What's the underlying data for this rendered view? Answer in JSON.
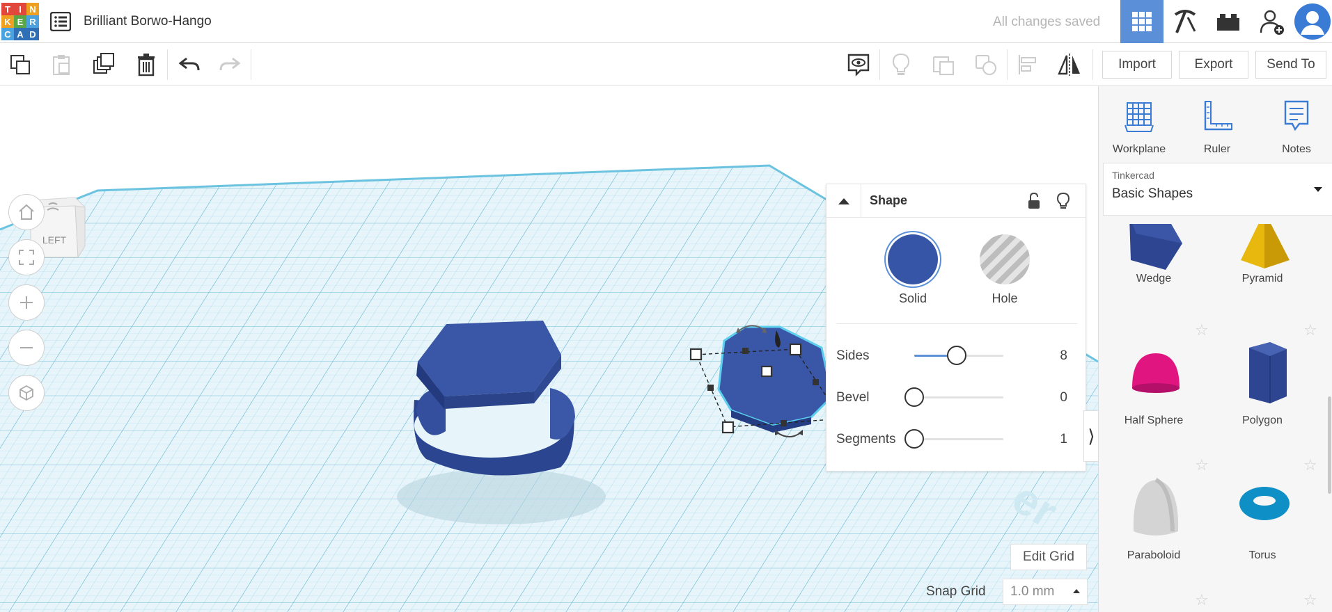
{
  "header": {
    "logo_letters": [
      "T",
      "I",
      "N",
      "K",
      "E",
      "R",
      "C",
      "A",
      "D"
    ],
    "logo_colors": [
      "#e2473b",
      "#e2473b",
      "#f0a020",
      "#f0a020",
      "#5ba646",
      "#4aa3df",
      "#4aa3df",
      "#2f6fb5",
      "#2f6fb5"
    ],
    "project_title": "Brilliant Borwo-Hango",
    "save_status": "All changes saved",
    "accent_color": "#5b8fd8"
  },
  "toolbar": {
    "import_label": "Import",
    "export_label": "Export",
    "send_to_label": "Send To"
  },
  "viewport": {
    "viewcube_label": "LEFT",
    "shape_color": "#2f4b9a",
    "grid_color": "#7fc8e0"
  },
  "inspector": {
    "title": "Shape",
    "solid_label": "Solid",
    "hole_label": "Hole",
    "solid_color": "#3655a6",
    "params": [
      {
        "label": "Sides",
        "value": "8",
        "fraction": 0.48
      },
      {
        "label": "Bevel",
        "value": "0",
        "fraction": 0.0
      },
      {
        "label": "Segments",
        "value": "1",
        "fraction": 0.0
      }
    ]
  },
  "grid_controls": {
    "edit_grid_label": "Edit Grid",
    "snap_grid_label": "Snap Grid",
    "snap_grid_value": "1.0 mm"
  },
  "panel": {
    "tools": [
      "Workplane",
      "Ruler",
      "Notes"
    ],
    "library_source": "Tinkercad",
    "library_name": "Basic Shapes",
    "shapes": [
      {
        "name": "Wedge",
        "icon": "wedge-icon"
      },
      {
        "name": "Pyramid",
        "icon": "pyramid-icon"
      },
      {
        "name": "Half Sphere",
        "icon": "half-sphere-icon"
      },
      {
        "name": "Polygon",
        "icon": "polygon-icon"
      },
      {
        "name": "Paraboloid",
        "icon": "paraboloid-icon"
      },
      {
        "name": "Torus",
        "icon": "torus-icon"
      }
    ]
  }
}
